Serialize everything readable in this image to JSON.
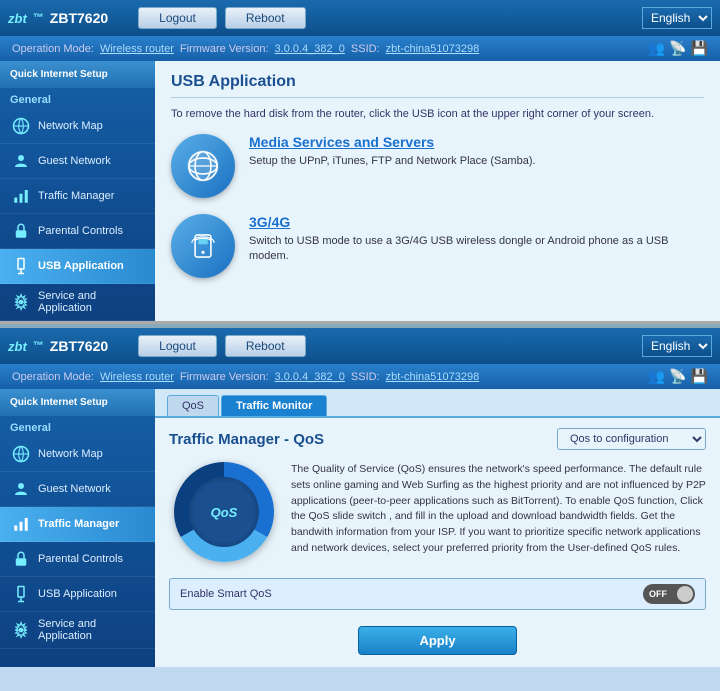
{
  "app": {
    "model": "ZBT7620",
    "logo": "zbt",
    "language": "English"
  },
  "header": {
    "logout_label": "Logout",
    "reboot_label": "Reboot",
    "lang_label": "English"
  },
  "subheader": {
    "operation_mode_label": "Operation Mode:",
    "operation_mode_value": "Wireless router",
    "firmware_label": "Firmware Version:",
    "firmware_value": "3.0.0.4_382_0",
    "ssid_label": "SSID:",
    "ssid_value": "zbt-china51073298"
  },
  "sidebar": {
    "quick_setup_label": "Quick Internet Setup",
    "general_label": "General",
    "items": [
      {
        "id": "network-map",
        "label": "Network Map",
        "active": false
      },
      {
        "id": "guest-network",
        "label": "Guest Network",
        "active": false
      },
      {
        "id": "traffic-manager",
        "label": "Traffic Manager",
        "active": false
      },
      {
        "id": "parental-controls",
        "label": "Parental Controls",
        "active": false
      },
      {
        "id": "usb-application",
        "label": "USB Application",
        "active": true
      },
      {
        "id": "service-application",
        "label": "Service and Application",
        "active": false
      }
    ]
  },
  "usb_page": {
    "title": "USB Application",
    "desc": "To remove the hard disk from the router, click the USB icon at the upper right corner of your screen.",
    "items": [
      {
        "id": "media-services",
        "title": "Media Services and Servers",
        "desc": "Setup the UPnP, iTunes, FTP and Network Place (Samba)."
      },
      {
        "id": "3g-4g",
        "title": "3G/4G",
        "desc": "Switch to USB mode to use a 3G/4G USB wireless dongle or Android phone as a USB modem."
      }
    ]
  },
  "panel2": {
    "subheader": {
      "operation_mode_label": "Operation Mode:",
      "operation_mode_value": "Wireless router",
      "firmware_label": "Firmware Version:",
      "firmware_value": "3.0.0.4_382_0",
      "ssid_label": "SSID:",
      "ssid_value": "zbt-china51073298"
    },
    "sidebar": {
      "quick_setup_label": "Quick Internet Setup",
      "general_label": "General",
      "items": [
        {
          "id": "network-map2",
          "label": "Network Map",
          "active": false
        },
        {
          "id": "guest-network2",
          "label": "Guest Network",
          "active": false
        },
        {
          "id": "traffic-manager2",
          "label": "Traffic Manager",
          "active": true
        },
        {
          "id": "parental-controls2",
          "label": "Parental Controls",
          "active": false
        },
        {
          "id": "usb-application2",
          "label": "USB Application",
          "active": false
        },
        {
          "id": "service-application2",
          "label": "Service and Application",
          "active": false
        }
      ]
    },
    "tabs": [
      {
        "id": "qos",
        "label": "QoS",
        "active": false
      },
      {
        "id": "traffic-monitor",
        "label": "Traffic Monitor",
        "active": true
      }
    ],
    "traffic_title": "Traffic Manager - QoS",
    "config_options": [
      "Qos to configuration"
    ],
    "config_selected": "Qos to configuration",
    "qos_desc": "The Quality of Service (QoS) ensures the network's speed performance. The default rule sets online gaming and Web Surfing as the highest priority and are not influenced by P2P applications (peer-to-peer applications such as BitTorrent). To enable QoS function, Click the QoS slide switch , and fill in the upload and download bandwidth fields. Get the bandwith information from your ISP.\nIf you want to prioritize specific network applications and network devices, select your preferred priority from the User-defined QoS rules.",
    "qos_logo": "QoS",
    "smart_qos_label": "Enable Smart QoS",
    "toggle_state": "OFF",
    "apply_label": "Apply"
  }
}
